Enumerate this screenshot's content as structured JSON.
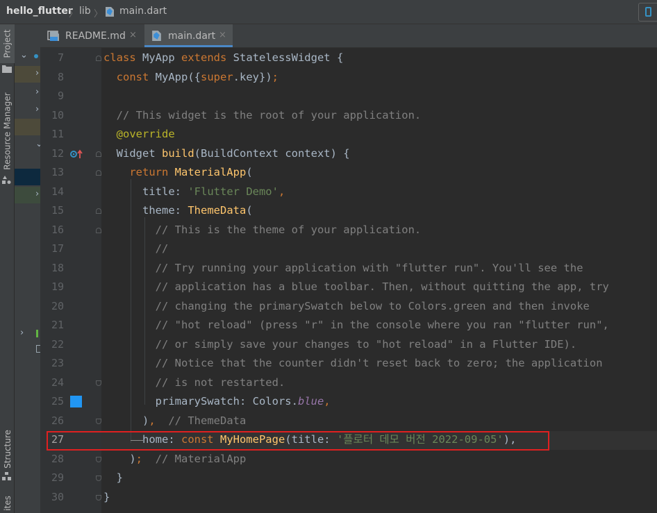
{
  "breadcrumb": {
    "project": "hello_flutter",
    "folder": "lib",
    "file": "main.dart"
  },
  "tool_windows": {
    "project": "Project",
    "resource_manager": "Resource Manager",
    "structure": "Structure",
    "favorites": "ites"
  },
  "tabs": [
    {
      "label": "README.md",
      "close": "×"
    },
    {
      "label": "main.dart",
      "close": "×"
    }
  ],
  "project_tree": {
    "arrows": [
      "⌄",
      "›",
      "›",
      "›",
      "⌄",
      "›",
      "›",
      "›"
    ]
  },
  "editor": {
    "line_numbers": [
      "7",
      "8",
      "9",
      "10",
      "11",
      "12",
      "13",
      "14",
      "15",
      "16",
      "17",
      "18",
      "19",
      "20",
      "21",
      "22",
      "23",
      "24",
      "25",
      "26",
      "27",
      "28",
      "29",
      "30"
    ],
    "lines": [
      [
        [
          "kw",
          "class "
        ],
        [
          "",
          "MyApp "
        ],
        [
          "kw",
          "extends "
        ],
        [
          "",
          "StatelessWidget {"
        ]
      ],
      [
        [
          "",
          "  "
        ],
        [
          "kw",
          "const "
        ],
        [
          "",
          "MyApp({"
        ],
        [
          "kw",
          "super"
        ],
        [
          "",
          ".key})"
        ],
        [
          "kw",
          ";"
        ]
      ],
      [
        [
          "",
          ""
        ]
      ],
      [
        [
          "cm",
          "  // This widget is the root of your application."
        ]
      ],
      [
        [
          "an",
          "  @override"
        ]
      ],
      [
        [
          "",
          "  Widget "
        ],
        [
          "fn",
          "build"
        ],
        [
          "",
          "(BuildContext context) {"
        ]
      ],
      [
        [
          "kw",
          "    return "
        ],
        [
          "fn",
          "MaterialApp"
        ],
        [
          "",
          "("
        ]
      ],
      [
        [
          "",
          "      title: "
        ],
        [
          "st",
          "'Flutter Demo'"
        ],
        [
          "kw",
          ","
        ]
      ],
      [
        [
          "",
          "      theme: "
        ],
        [
          "fn",
          "ThemeData"
        ],
        [
          "",
          "("
        ]
      ],
      [
        [
          "cm",
          "        // This is the theme of your application."
        ]
      ],
      [
        [
          "cm",
          "        //"
        ]
      ],
      [
        [
          "cm",
          "        // Try running your application with \"flutter run\". You'll see the"
        ]
      ],
      [
        [
          "cm",
          "        // application has a blue toolbar. Then, without quitting the app, try"
        ]
      ],
      [
        [
          "cm",
          "        // changing the primarySwatch below to Colors.green and then invoke"
        ]
      ],
      [
        [
          "cm",
          "        // \"hot reload\" (press \"r\" in the console where you ran \"flutter run\","
        ]
      ],
      [
        [
          "cm",
          "        // or simply save your changes to \"hot reload\" in a Flutter IDE)."
        ]
      ],
      [
        [
          "cm",
          "        // Notice that the counter didn't reset back to zero; the application"
        ]
      ],
      [
        [
          "cm",
          "        // is not restarted."
        ]
      ],
      [
        [
          "",
          "        primarySwatch: Colors."
        ],
        [
          "it",
          "blue"
        ],
        [
          "kw",
          ","
        ]
      ],
      [
        [
          "",
          "      )"
        ],
        [
          "kw",
          ","
        ],
        [
          "cm",
          "  // ThemeData"
        ]
      ],
      [
        [
          "",
          "      home: "
        ],
        [
          "kw",
          "const "
        ],
        [
          "fn",
          "MyHomePage"
        ],
        [
          "",
          "(title: "
        ],
        [
          "st",
          "'플로터 데모 버전 2022-09-05'"
        ],
        [
          "",
          "),"
        ]
      ],
      [
        [
          "",
          "    )"
        ],
        [
          "kw",
          ";"
        ],
        [
          "cm",
          "  // MaterialApp"
        ]
      ],
      [
        [
          "",
          "  }"
        ]
      ],
      [
        [
          "",
          "}"
        ]
      ]
    ]
  },
  "colors": {
    "accent": "#4a88c7",
    "swatch": "#2196f3",
    "highlight_box": "#e02020"
  }
}
